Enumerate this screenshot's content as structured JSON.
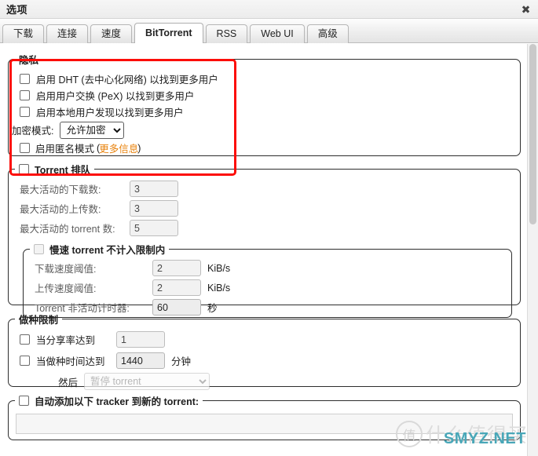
{
  "window": {
    "title": "选项",
    "close_icon": "close-icon",
    "close_glyph": "✖"
  },
  "tabs": [
    {
      "label": "下载",
      "active": false
    },
    {
      "label": "连接",
      "active": false
    },
    {
      "label": "速度",
      "active": false
    },
    {
      "label": "BitTorrent",
      "active": true
    },
    {
      "label": "RSS",
      "active": false
    },
    {
      "label": "Web UI",
      "active": false
    },
    {
      "label": "高级",
      "active": false
    }
  ],
  "privacy": {
    "legend": "隐私",
    "dht_label": "启用 DHT (去中心化网络) 以找到更多用户",
    "dht_checked": false,
    "pex_label": "启用用户交换 (PeX) 以找到更多用户",
    "pex_checked": false,
    "lsd_label": "启用本地用户发现以找到更多用户",
    "lsd_checked": false,
    "encryption_label": "加密模式:",
    "encryption_value": "允许加密",
    "encryption_options": [
      "允许加密"
    ],
    "anonymous_label": "启用匿名模式",
    "anonymous_checked": false,
    "more_info_open": "(",
    "more_info_link": "更多信息",
    "more_info_close": ")"
  },
  "queue": {
    "legend": "Torrent 排队",
    "legend_checked": false,
    "rows": [
      {
        "label": "最大活动的下载数:",
        "value": "3"
      },
      {
        "label": "最大活动的上传数:",
        "value": "3"
      },
      {
        "label": "最大活动的 torrent 数:",
        "value": "5"
      }
    ],
    "slow": {
      "legend": "慢速 torrent 不计入限制内",
      "legend_checked": false,
      "rows": [
        {
          "label": "下载速度阈值:",
          "value": "2",
          "unit": "KiB/s"
        },
        {
          "label": "上传速度阈值:",
          "value": "2",
          "unit": "KiB/s"
        },
        {
          "label": "Torrent 非活动计时器:",
          "value": "60",
          "unit": "秒"
        }
      ]
    }
  },
  "seeding": {
    "legend": "做种限制",
    "ratio_label": "当分享率达到",
    "ratio_checked": false,
    "ratio_value": "1",
    "time_label": "当做种时间达到",
    "time_checked": false,
    "time_value": "1440",
    "time_unit": "分钟",
    "then_label": "然后",
    "then_value": "暂停 torrent",
    "then_options": [
      "暂停 torrent"
    ]
  },
  "tracker": {
    "legend": "自动添加以下 tracker 到新的 torrent:",
    "legend_checked": false,
    "textarea_value": ""
  },
  "annotation": {
    "color": "#fc0d08",
    "name": "privacy-highlight-rectangle"
  },
  "watermark": {
    "badge": "值",
    "text": "什么值得买",
    "site": "SMYZ.NET",
    "site_color": "#49a7b8"
  }
}
